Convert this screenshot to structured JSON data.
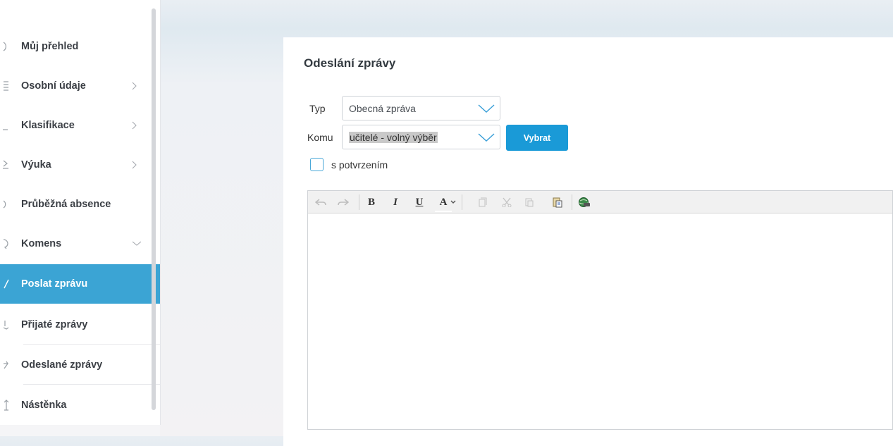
{
  "sidebar": {
    "items": [
      {
        "label": "Můj přehled",
        "icon": "dashboard-icon",
        "chevron": ""
      },
      {
        "label": "Osobní údaje",
        "icon": "document-icon",
        "chevron": "right"
      },
      {
        "label": "Klasifikace",
        "icon": "grades-icon",
        "chevron": "right"
      },
      {
        "label": "Výuka",
        "icon": "teaching-icon",
        "chevron": "right"
      },
      {
        "label": "Průběžná absence",
        "icon": "absence-icon",
        "chevron": ""
      },
      {
        "label": "Komens",
        "icon": "messages-icon",
        "chevron": "down"
      },
      {
        "label": "Poslat zprávu",
        "icon": "send-icon",
        "chevron": "",
        "active": true
      },
      {
        "label": "Přijaté zprávy",
        "icon": "inbox-icon",
        "chevron": ""
      },
      {
        "label": "Odeslané zprávy",
        "icon": "sent-icon",
        "chevron": ""
      },
      {
        "label": "Nástěnka",
        "icon": "board-icon",
        "chevron": ""
      }
    ]
  },
  "main": {
    "title": "Odeslání zprávy",
    "form": {
      "typ_label": "Typ",
      "typ_value": "Obecná zpráva",
      "komu_label": "Komu",
      "komu_value": "učitelé - volný výběr",
      "vybrat_label": "Vybrat",
      "confirm_label": "s potvrzením",
      "confirm_checked": false
    },
    "editor": {
      "toolbar": [
        {
          "name": "undo-icon",
          "glyph": "↶"
        },
        {
          "name": "redo-icon",
          "glyph": "↷"
        },
        {
          "name": "bold-button",
          "glyph": "B"
        },
        {
          "name": "italic-button",
          "glyph": "I"
        },
        {
          "name": "underline-button",
          "glyph": "U"
        },
        {
          "name": "font-color-button",
          "glyph": "A"
        },
        {
          "name": "copy-icon",
          "glyph": "❐"
        },
        {
          "name": "cut-icon",
          "glyph": "✂"
        },
        {
          "name": "paste-icon",
          "glyph": "📋"
        },
        {
          "name": "paste-word-icon",
          "glyph": "📄"
        },
        {
          "name": "insert-link-icon",
          "glyph": "🌐"
        }
      ],
      "content": ""
    }
  },
  "colors": {
    "accent": "#1a9ad7",
    "active_item": "#3ba4d4",
    "checkbox_border": "#4aa8d8"
  }
}
